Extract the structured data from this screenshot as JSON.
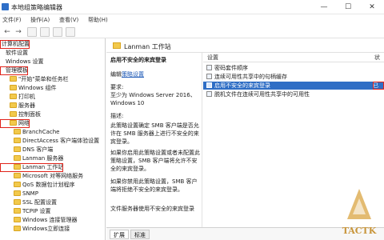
{
  "window": {
    "title": "本地组策略编辑器",
    "min_glyph": "—",
    "max_glyph": "☐",
    "close_glyph": "✕"
  },
  "menu": [
    "文件(F)",
    "操作(A)",
    "查看(V)",
    "帮助(H)"
  ],
  "toolbar": {
    "back_glyph": "←",
    "forward_glyph": "→"
  },
  "tree": [
    {
      "label": "计算机配置",
      "indent": 0,
      "folder": false,
      "boxed": true
    },
    {
      "label": "软件设置",
      "indent": 1,
      "folder": false,
      "boxed": false
    },
    {
      "label": "Windows 设置",
      "indent": 1,
      "folder": false,
      "boxed": false
    },
    {
      "label": "管理模板",
      "indent": 1,
      "folder": false,
      "boxed": true
    },
    {
      "label": "\"开始\"菜单和任务栏",
      "indent": 2,
      "folder": true,
      "boxed": false
    },
    {
      "label": "Windows 组件",
      "indent": 2,
      "folder": true,
      "boxed": false
    },
    {
      "label": "打印机",
      "indent": 2,
      "folder": true,
      "boxed": false
    },
    {
      "label": "服务器",
      "indent": 2,
      "folder": true,
      "boxed": false
    },
    {
      "label": "控制面板",
      "indent": 2,
      "folder": true,
      "boxed": false
    },
    {
      "label": "网络",
      "indent": 2,
      "folder": true,
      "boxed": true
    },
    {
      "label": "BranchCache",
      "indent": 3,
      "folder": true,
      "boxed": false
    },
    {
      "label": "DirectAccess 客户端体验设置",
      "indent": 3,
      "folder": true,
      "boxed": false
    },
    {
      "label": "DNS 客户端",
      "indent": 3,
      "folder": true,
      "boxed": false
    },
    {
      "label": "Lanman 服务器",
      "indent": 3,
      "folder": true,
      "boxed": false
    },
    {
      "label": "Lanman 工作站",
      "indent": 3,
      "folder": true,
      "boxed": true
    },
    {
      "label": "Microsoft 对等网络服务",
      "indent": 3,
      "folder": true,
      "boxed": false
    },
    {
      "label": "QoS 数据包计划程序",
      "indent": 3,
      "folder": true,
      "boxed": false
    },
    {
      "label": "SNMP",
      "indent": 3,
      "folder": true,
      "boxed": false
    },
    {
      "label": "SSL 配置设置",
      "indent": 3,
      "folder": true,
      "boxed": false
    },
    {
      "label": "TCPIP 设置",
      "indent": 3,
      "folder": true,
      "boxed": false
    },
    {
      "label": "Windows 连接管理器",
      "indent": 3,
      "folder": true,
      "boxed": false
    },
    {
      "label": "Windows立即连接",
      "indent": 3,
      "folder": true,
      "boxed": false
    }
  ],
  "policy_header": "Lanman 工作站",
  "description": {
    "title": "启用不安全的来宾登录",
    "edit_prefix": "编辑",
    "edit_link": "策略设置",
    "requirements_label": "要求:",
    "requirements": "至少为 Windows Server 2016、Windows 10",
    "desc_label": "描述:",
    "p1": "此策略设置确定 SMB 客户端是否允许在 SMB 服务器上进行不安全的来宾登录。",
    "p2": "如果你启用此策略设置或者未配置此策略设置，SMB 客户端将允许不安全的来宾登录。",
    "p3": "如果你禁用此策略设置，SMB 客户端将拒绝不安全的来宾登录。",
    "p4": "文件服务器使用不安全的来宾登录"
  },
  "settings": {
    "column_header": "设置",
    "state_header": "状",
    "rows": [
      {
        "label": "密码套件顺序",
        "selected": false
      },
      {
        "label": "连续可用性共享中的句柄缓存",
        "selected": false
      },
      {
        "label": "启用不安全的来宾登录",
        "selected": true,
        "state": "已"
      },
      {
        "label": "脱机文件在连续可用性共享中的可用性",
        "selected": false
      }
    ]
  },
  "tabs": [
    "扩展",
    "标准"
  ],
  "watermark": {
    "text": "TACTK"
  },
  "colors": {
    "selection": "#2f6ec5",
    "highlight_box": "#e0231a",
    "folder": "#f2c94c",
    "link": "#1c58b6"
  }
}
